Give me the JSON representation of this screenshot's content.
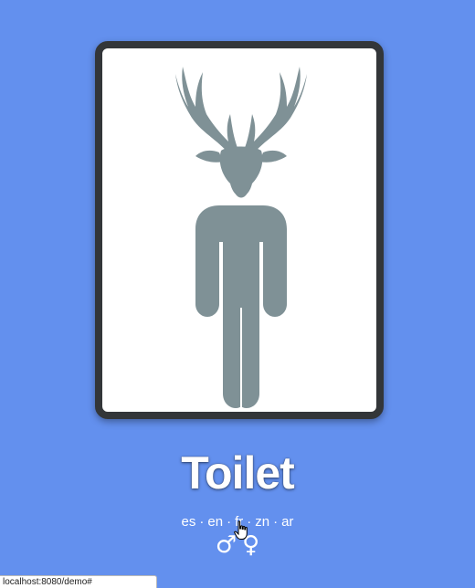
{
  "sign": {
    "title": "Toilet",
    "figure_icon": "deer-man-icon",
    "figure_color": "#7f9196",
    "frame_color": "#333639"
  },
  "languages": [
    {
      "code": "es",
      "label": "es"
    },
    {
      "code": "en",
      "label": "en"
    },
    {
      "code": "fr",
      "label": "fr"
    },
    {
      "code": "zn",
      "label": "zn"
    },
    {
      "code": "ar",
      "label": "ar"
    }
  ],
  "language_separator": "·",
  "gender_symbols": {
    "male": "♂",
    "female": "♀"
  },
  "status_bar": {
    "url": "localhost:8080/demo#"
  },
  "colors": {
    "background": "#6390ee",
    "text": "#ffffff"
  }
}
